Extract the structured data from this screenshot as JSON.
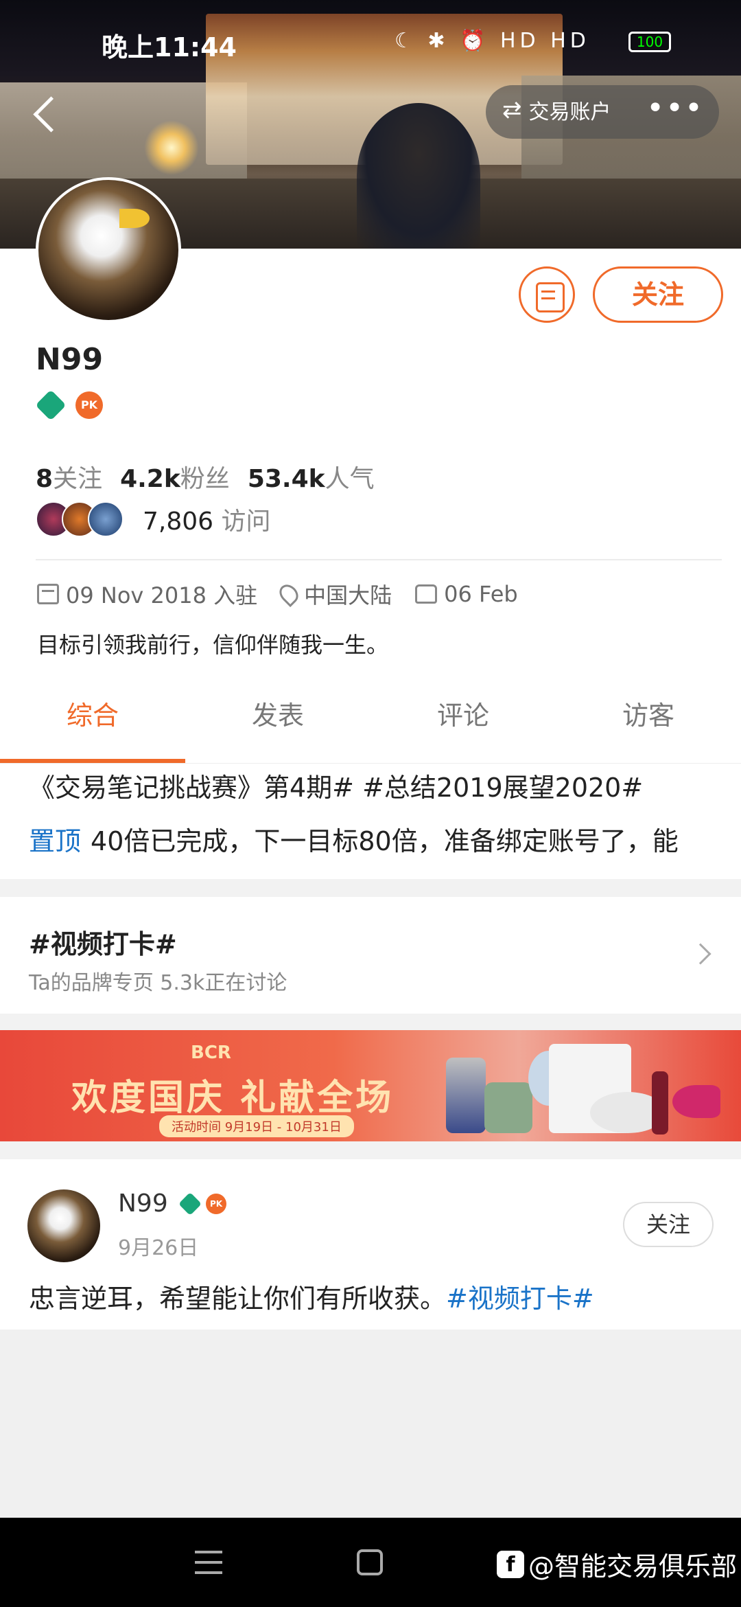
{
  "status_bar": {
    "time": "晚上11:44",
    "icons_text": "☾ ✱ ⏰ HD HD",
    "battery": "100"
  },
  "header": {
    "trade_account_label": "交易账户",
    "more_icon": "more-icon"
  },
  "profile": {
    "name": "N99",
    "follow_label": "关注",
    "pk_badge": "PK",
    "stats": {
      "following_count": "8",
      "following_label": "关注",
      "fans_count": "4.2k",
      "fans_label": "粉丝",
      "popularity_count": "53.4k",
      "popularity_label": "人气"
    },
    "visits_count": "7,806",
    "visits_label": "访问",
    "joined": "09 Nov 2018 入驻",
    "location": "中国大陆",
    "birthday": "06 Feb",
    "bio": "目标引领我前行，信仰伴随我一生。"
  },
  "tabs": [
    {
      "label": "综合",
      "active": true
    },
    {
      "label": "发表",
      "active": false
    },
    {
      "label": "评论",
      "active": false
    },
    {
      "label": "访客",
      "active": false
    }
  ],
  "pinned": {
    "title": "《交易笔记挑战赛》第4期# #总结2019展望2020#",
    "tag": "置顶",
    "text": "40倍已完成，下一目标80倍，准备绑定账号了，能"
  },
  "topic": {
    "title": "#视频打卡#",
    "subtitle": "Ta的品牌专页  5.3k正在讨论"
  },
  "ad": {
    "logo": "BCR",
    "title": "欢度国庆  礼献全场",
    "date": "活动时间 9月19日 - 10月31日"
  },
  "post": {
    "name": "N99",
    "pk_badge": "PK",
    "date": "9月26日",
    "follow_label": "关注",
    "text": "忠言逆耳，希望能让你们有所收获。",
    "tag": "#视频打卡#"
  },
  "watermark": {
    "icon_letter": "f",
    "text": "@智能交易俱乐部"
  }
}
